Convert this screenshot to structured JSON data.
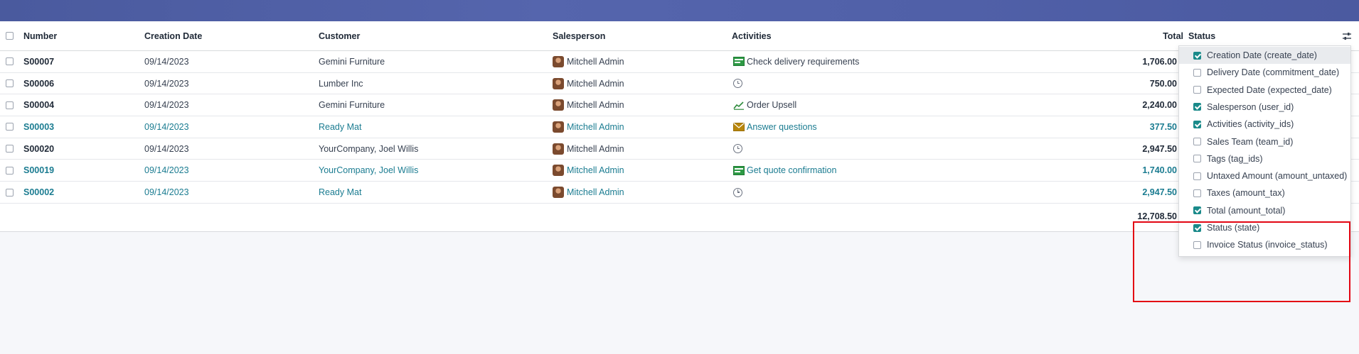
{
  "table": {
    "columns": {
      "number": "Number",
      "creation_date": "Creation Date",
      "customer": "Customer",
      "salesperson": "Salesperson",
      "activities": "Activities",
      "total": "Total",
      "status": "Status"
    },
    "rows": [
      {
        "number": "S00007",
        "date": "09/14/2023",
        "customer": "Gemini Furniture",
        "salesperson": "Mitchell Admin",
        "activity_icon": "delivery-icon",
        "activity": "Check delivery requirements",
        "total": "1,706.00",
        "highlight": false
      },
      {
        "number": "S00006",
        "date": "09/14/2023",
        "customer": "Lumber Inc",
        "salesperson": "Mitchell Admin",
        "activity_icon": "clock-icon",
        "activity": "",
        "total": "750.00",
        "highlight": false
      },
      {
        "number": "S00004",
        "date": "09/14/2023",
        "customer": "Gemini Furniture",
        "salesperson": "Mitchell Admin",
        "activity_icon": "chart-icon",
        "activity": "Order Upsell",
        "total": "2,240.00",
        "highlight": false
      },
      {
        "number": "S00003",
        "date": "09/14/2023",
        "customer": "Ready Mat",
        "salesperson": "Mitchell Admin",
        "activity_icon": "envelope-icon",
        "activity": "Answer questions",
        "total": "377.50",
        "highlight": true
      },
      {
        "number": "S00020",
        "date": "09/14/2023",
        "customer": "YourCompany, Joel Willis",
        "salesperson": "Mitchell Admin",
        "activity_icon": "clock-icon",
        "activity": "",
        "total": "2,947.50",
        "highlight": false
      },
      {
        "number": "S00019",
        "date": "09/14/2023",
        "customer": "YourCompany, Joel Willis",
        "salesperson": "Mitchell Admin",
        "activity_icon": "delivery-icon",
        "activity": "Get quote confirmation",
        "total": "1,740.00",
        "highlight": true
      },
      {
        "number": "S00002",
        "date": "09/14/2023",
        "customer": "Ready Mat",
        "salesperson": "Mitchell Admin",
        "activity_icon": "clock-icon",
        "activity": "",
        "total": "2,947.50",
        "highlight": true
      }
    ],
    "grand_total": "12,708.50"
  },
  "optional_columns": [
    {
      "label": "Creation Date (create_date)",
      "checked": true
    },
    {
      "label": "Delivery Date (commitment_date)",
      "checked": false
    },
    {
      "label": "Expected Date (expected_date)",
      "checked": false
    },
    {
      "label": "Salesperson (user_id)",
      "checked": true
    },
    {
      "label": "Activities (activity_ids)",
      "checked": true
    },
    {
      "label": "Sales Team (team_id)",
      "checked": false
    },
    {
      "label": "Tags (tag_ids)",
      "checked": false
    },
    {
      "label": "Untaxed Amount (amount_untaxed)",
      "checked": false
    },
    {
      "label": "Taxes (amount_tax)",
      "checked": false
    },
    {
      "label": "Total (amount_total)",
      "checked": true
    },
    {
      "label": "Status (state)",
      "checked": true
    },
    {
      "label": "Invoice Status (invoice_status)",
      "checked": false
    }
  ],
  "colors": {
    "banner": "#4f5fa7",
    "link": "#1b7c91",
    "checkbox_on": "#1a8a8a",
    "annotation": "#e30613"
  }
}
